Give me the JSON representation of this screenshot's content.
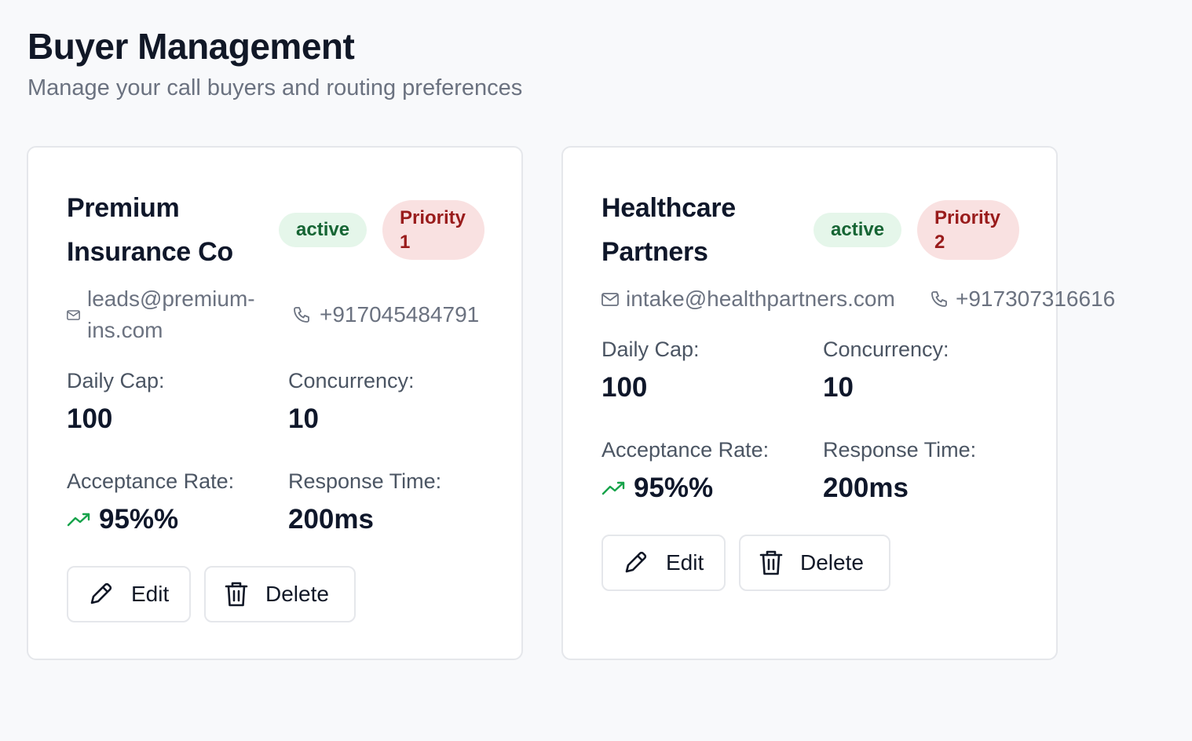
{
  "header": {
    "title": "Buyer Management",
    "subtitle": "Manage your call buyers and routing preferences"
  },
  "colors": {
    "active_badge_bg": "#e5f6ea",
    "active_badge_text": "#166534",
    "priority_badge_bg": "#f9e1e1",
    "priority_badge_text": "#991b1b",
    "trend_green": "#16a34a"
  },
  "icons": {
    "email": "mail-icon",
    "phone": "phone-icon",
    "trend": "trending-up-icon",
    "edit": "pencil-icon",
    "delete": "trash-icon"
  },
  "labels": {
    "daily_cap": "Daily Cap:",
    "concurrency": "Concurrency:",
    "acceptance_rate": "Acceptance Rate:",
    "response_time": "Response Time:",
    "edit": "Edit",
    "delete": "Delete"
  },
  "buyers": [
    {
      "name_line1": "Premium",
      "name_line2": "Insurance Co",
      "status": "active",
      "priority_line1": "Priority",
      "priority_line2": "1",
      "email_line1": "leads@premium-",
      "email_line2": "ins.com",
      "phone": "+917045484791",
      "daily_cap": "100",
      "concurrency": "10",
      "acceptance_rate": "95%%",
      "response_time": "200ms"
    },
    {
      "name_line1": "Healthcare",
      "name_line2": "Partners",
      "status": "active",
      "priority_line1": "Priority",
      "priority_line2": "2",
      "email": "intake@healthpartners.com",
      "phone": "+917307316616",
      "daily_cap": "100",
      "concurrency": "10",
      "acceptance_rate": "95%%",
      "response_time": "200ms"
    }
  ]
}
